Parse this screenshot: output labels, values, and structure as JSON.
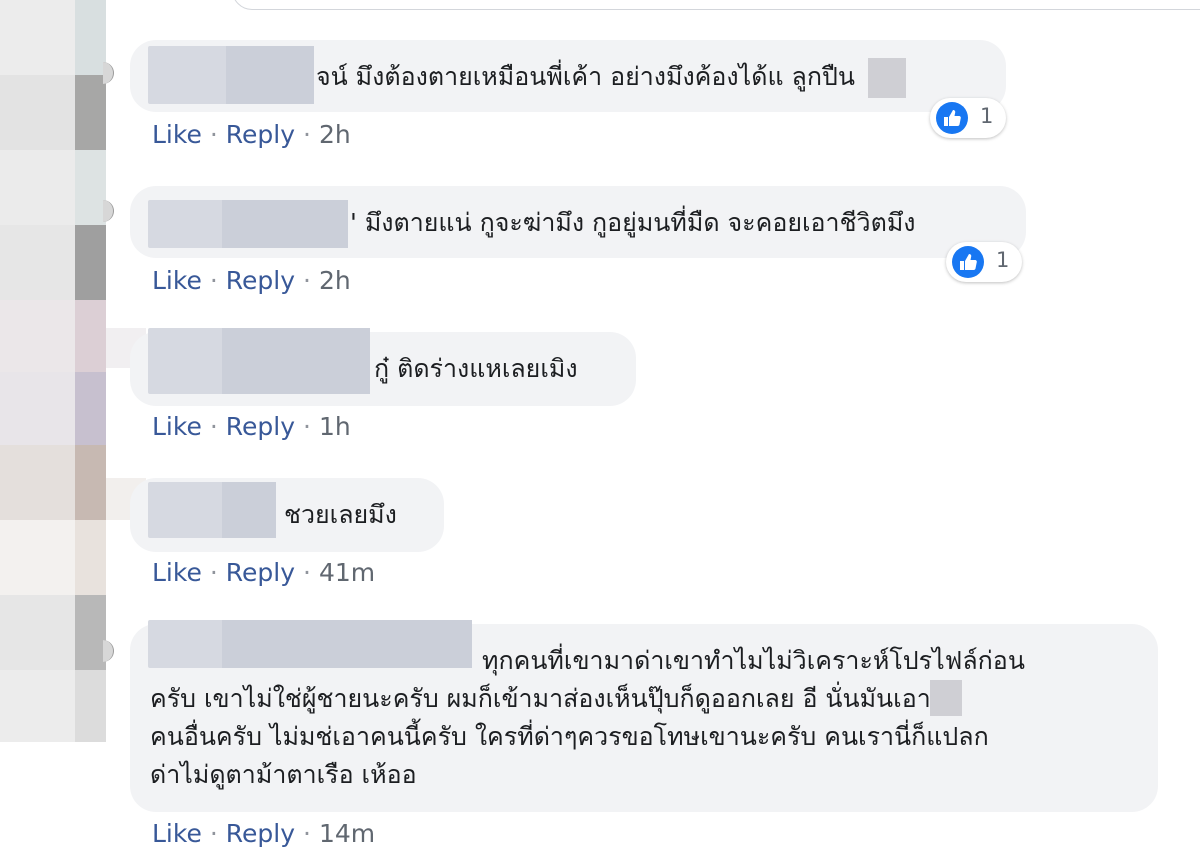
{
  "comments": [
    {
      "text": "จน์ มึงต้องตายเหมือนพี่เค้า อย่างมึงค้องได้แ    ลูกปืน",
      "reactions": 1,
      "actions": {
        "like": "Like",
        "reply": "Reply",
        "time": "2h"
      }
    },
    {
      "text": "' มึงตายแน่ กูจะฆ่ามึง กูอยู่มนที่มืด จะคอยเอาชีวิตมึง",
      "reactions": 1,
      "actions": {
        "like": "Like",
        "reply": "Reply",
        "time": "2h"
      }
    },
    {
      "text": "กู๋ ติดร่างแหเลยเมิง",
      "actions": {
        "like": "Like",
        "reply": "Reply",
        "time": "1h"
      }
    },
    {
      "text": "ชวยเลยมึง",
      "actions": {
        "like": "Like",
        "reply": "Reply",
        "time": "41m"
      }
    },
    {
      "lines": [
        "ทุกคนที่เขามาด่าเขาทำไมไม่วิเคราะห์โปรไฟล์ก่อน",
        "ครับ เขาไม่ใช่ผู้ชายนะครับ ผมก็เข้ามาส่องเห็นปุ๊บก็ดูออกเลย อี      นั่นมันเอา",
        "คนอื่นครับ ไม่มช่เอาคนนี้ครับ ใครที่ด่าๆควรขอโทษเขานะครับ คนเรานี่ก็แปลก",
        "ด่าไม่ดูตาม้าตาเรือ เห้ออ"
      ],
      "actions": {
        "like": "Like",
        "reply": "Reply",
        "time": "14m"
      }
    }
  ],
  "icons": {
    "reaction": "like-thumb-icon"
  },
  "colors": {
    "link": "#385898",
    "meta": "#606770",
    "bubble": "#f2f3f5",
    "like_blue": "#1877f2"
  }
}
